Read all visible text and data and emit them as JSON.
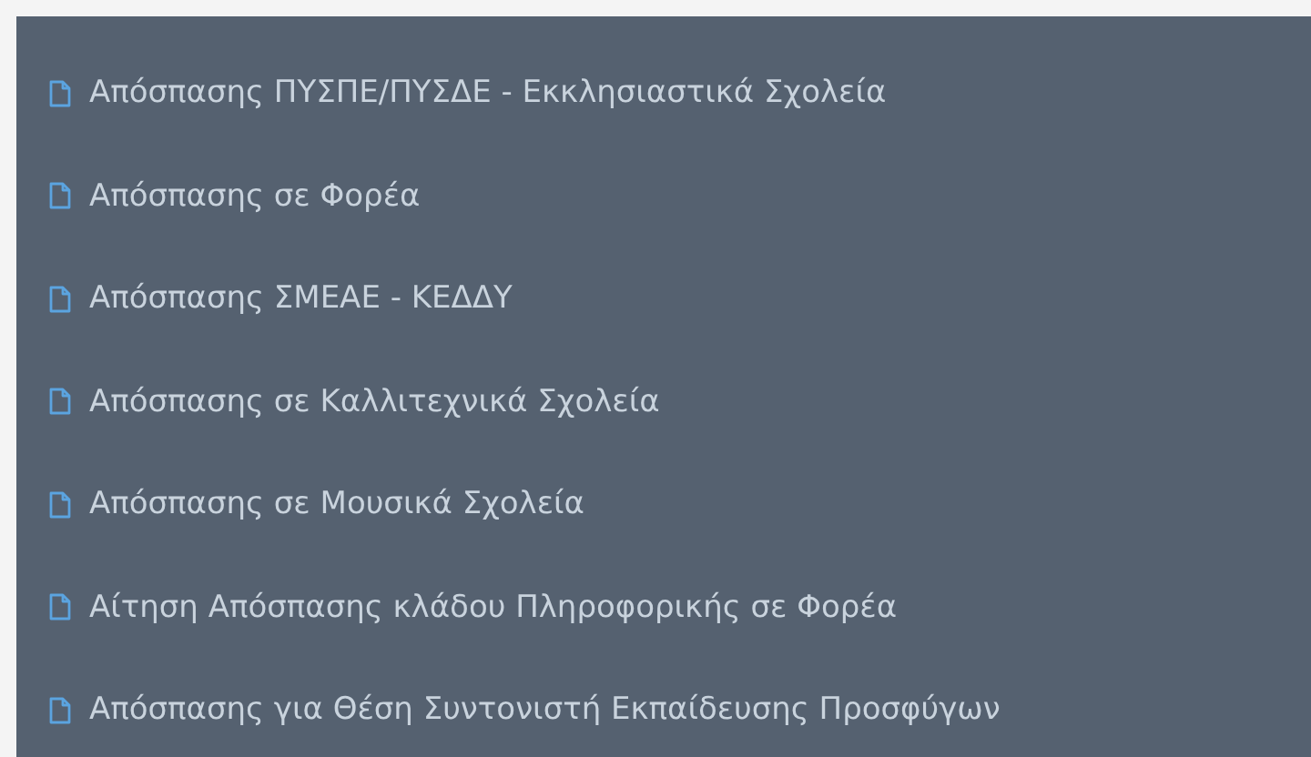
{
  "menu": {
    "items": [
      {
        "label": "Απόσπασης ΠΥΣΠΕ/ΠΥΣΔΕ - Εκκλησιαστικά Σχολεία"
      },
      {
        "label": "Απόσπασης σε Φορέα"
      },
      {
        "label": "Απόσπασης ΣΜΕΑΕ - ΚΕΔΔΥ"
      },
      {
        "label": "Απόσπασης σε Καλλιτεχνικά Σχολεία"
      },
      {
        "label": "Απόσπασης σε Μουσικά Σχολεία"
      },
      {
        "label": "Αίτηση Απόσπασης κλάδου Πληροφορικής σε Φορέα"
      },
      {
        "label": "Απόσπασης για Θέση Συντονιστή Εκπαίδευσης Προσφύγων"
      }
    ]
  }
}
